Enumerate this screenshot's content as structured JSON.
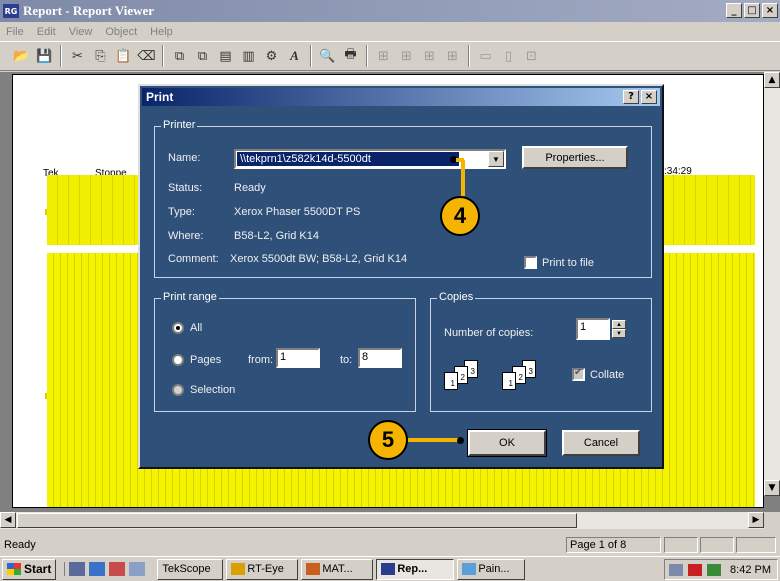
{
  "window": {
    "icon_text": "RG",
    "title": "Report - Report Viewer",
    "min": "_",
    "max": "□",
    "close": "×"
  },
  "menu": [
    "File",
    "Edit",
    "View",
    "Object",
    "Help"
  ],
  "document": {
    "tek": "Tek",
    "status": "Stoppe",
    "time": ":34:29"
  },
  "dialog": {
    "title": "Print",
    "help": "?",
    "close": "×",
    "printer": {
      "group_label": "Printer",
      "name_label": "Name:",
      "name_value": "\\\\tekprn1\\z582k14d-5500dt",
      "properties": "Properties...",
      "status_label": "Status:",
      "status_value": "Ready",
      "type_label": "Type:",
      "type_value": "Xerox Phaser 5500DT PS",
      "where_label": "Where:",
      "where_value": "B58-L2, Grid K14",
      "comment_label": "Comment:",
      "comment_value": "Xerox 5500dt BW; B58-L2, Grid K14",
      "print_to_file": "Print to file"
    },
    "range": {
      "group_label": "Print range",
      "all": "All",
      "pages": "Pages",
      "from_label": "from:",
      "from_value": "1",
      "to_label": "to:",
      "to_value": "8",
      "selection": "Selection"
    },
    "copies": {
      "group_label": "Copies",
      "number_label": "Number of copies:",
      "number_value": "1",
      "collate": "Collate"
    },
    "ok": "OK",
    "cancel": "Cancel"
  },
  "callouts": {
    "four": "4",
    "five": "5"
  },
  "status": {
    "ready": "Ready",
    "page": "Page 1 of 8"
  },
  "taskbar": {
    "start": "Start",
    "tasks": [
      "TekScope",
      "RT-Eye",
      "MAT...",
      "Rep...",
      "Pain..."
    ],
    "clock": "8:42 PM"
  },
  "colors": {
    "dialog_bg": "#2e5079",
    "callout": "#f4b400",
    "waveform": "#f3f200"
  }
}
